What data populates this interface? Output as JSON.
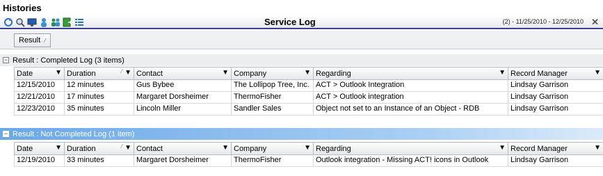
{
  "window": {
    "title": "Histories"
  },
  "toolbar": {
    "title": "Service Log",
    "date_range": "(2) - 11/25/2010 - 12/25/2010",
    "icons": [
      "refresh-icon",
      "search-icon",
      "monitor-icon",
      "person-icon",
      "people-icon",
      "export-icon",
      "list-icon"
    ]
  },
  "groupby": {
    "chip_label": "Result",
    "sort_glyph": "⁄"
  },
  "columns": [
    "Date",
    "Duration",
    "Contact",
    "Company",
    "Regarding",
    "Record Manager"
  ],
  "groups": [
    {
      "header": "Result : Completed Log (3 items)",
      "expander": "⊟",
      "rows": [
        [
          "12/15/2010",
          "12 minutes",
          "Gus Bybee",
          "The Lollipop Tree, Inc.",
          "ACT > Outlook Integration",
          "Lindsay Garrison"
        ],
        [
          "12/21/2010",
          "17 minutes",
          "Margaret Dorsheimer",
          "ThermoFisher",
          "ACT > Outlook integration",
          "Lindsay Garrison"
        ],
        [
          "12/23/2010",
          "35 minutes",
          "Lincoln Miller",
          "Sandler Sales",
          "Object not set to an Instance of an Object - RDB",
          "Lindsay Garrison"
        ]
      ]
    },
    {
      "header": "Result : Not Completed Log (1 item)",
      "expander": "⊟",
      "rows": [
        [
          "12/19/2010",
          "33 minutes",
          "Margaret Dorsheimer",
          "ThermoFisher",
          "Outlook integration - Missing ACT! icons in Outlook",
          "Lindsay Garrison"
        ]
      ]
    }
  ],
  "colors": {
    "accent_bar": "#3b3f9a",
    "selected_group": "#6aa8e8"
  }
}
